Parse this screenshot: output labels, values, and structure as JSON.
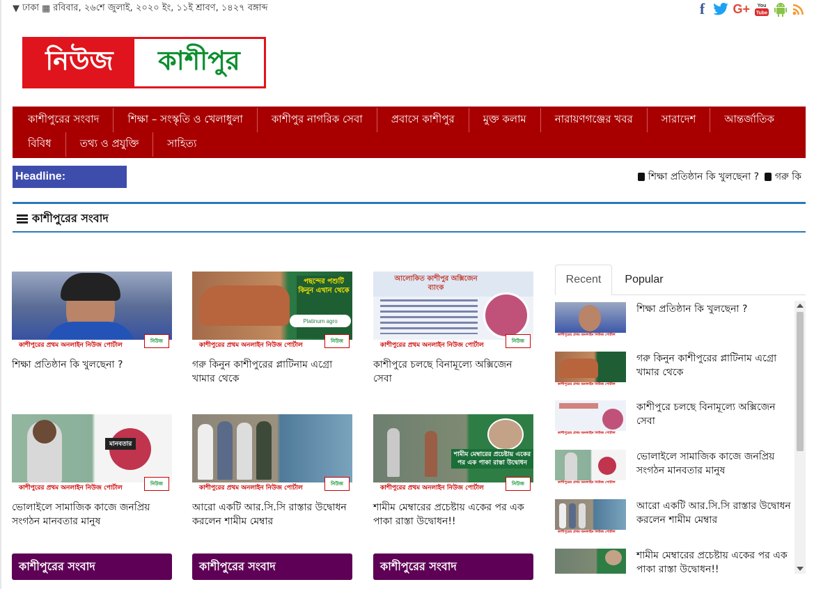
{
  "topbar": {
    "location": "ঢাকা",
    "date": "রবিবার, ২৬শে জুলাই, ২০২০ ইং, ১১ই শ্রাবণ, ১৪২৭ বঙ্গাব্দ",
    "social": [
      "f",
      "t",
      "G+",
      "You Tube",
      "android",
      "rss"
    ]
  },
  "logo": {
    "part1": "নিউজ",
    "part2": "কাশীপুর"
  },
  "nav": {
    "row1": [
      "কাশীপুরের সংবাদ",
      "শিক্ষা – সংস্কৃতি ও খেলাধুলা",
      "কাশীপুর নাগরিক সেবা",
      "প্রবাসে কাশীপুর",
      "মুক্ত কলাম",
      "নারায়ণগঞ্জের খবর",
      "সারাদেশ",
      "আন্তর্জাতিক"
    ],
    "row2": [
      "বিবিধ",
      "তথ্য ও প্রযুক্তি",
      "সাহিত্য"
    ]
  },
  "headline": {
    "label": "Headline:",
    "items": [
      "শিক্ষা প্রতিষ্ঠান কি খুলছেনা ?",
      "গরু কি"
    ]
  },
  "section": {
    "title": "কাশীপুরের সংবাদ"
  },
  "cards": [
    {
      "title": "শিক্ষা প্রতিষ্ঠান কি খুলছেনা ?",
      "band": "কাশীপুরের প্রথম অনলাইন নিউজ পোর্টাল",
      "thumb_color": "#3a62c0"
    },
    {
      "title": "গরু কিনুন কাশীপুরের প্লাটিনাম এগ্রো খামার থেকে",
      "band": "কাশীপুরের প্রথম অনলাইন নিউজ পোর্টাল",
      "overlay": "পছন্দের পশুটি কিনুন এখান থেকে",
      "thumb_color": "#8a6b3f"
    },
    {
      "title": "কাশীপুরে চলছে বিনামূল্যে অক্সিজেন সেবা",
      "band": "কাশীপুরের প্রথম অনলাইন নিউজ পোর্টাল",
      "overlay": "আলোকিত কাশীপুর অক্সিজেন ব্যাংক",
      "thumb_color": "#e9eef6"
    },
    {
      "title": "ভোলাইলে সামাজিক কাজে জনপ্রিয় সংগঠন মানবতার মানুষ",
      "band": "কাশীপুরের প্রথম অনলাইন নিউজ পোর্টাল",
      "overlay": "মানবতার",
      "thumb_color": "#8fb29a"
    },
    {
      "title": "আরো একটি আর.সি.সি রাস্তার উদ্বোধন করলেন শামীম মেম্বার",
      "band": "কাশীপুরের প্রথম অনলাইন নিউজ পোর্টাল",
      "thumb_color": "#8c8477"
    },
    {
      "title": "শামীম মেম্বারের প্রচেষ্টায় একের পর এক পাকা রাস্তা উদ্বোধন!!",
      "band": "কাশীপুরের প্রথম অনলাইন নিউজ পোর্টাল",
      "overlay": "শামীম মেম্বারের প্রচেষ্টায় একের পর এক পাকা রাস্তা উদ্বোধন",
      "thumb_color": "#6f7c6c"
    }
  ],
  "category_buttons": [
    "কাশীপুরের সংবাদ",
    "কাশীপুরের সংবাদ",
    "কাশীপুরের সংবাদ"
  ],
  "sidebar": {
    "tabs": [
      "Recent",
      "Popular"
    ],
    "items": [
      "শিক্ষা প্রতিষ্ঠান কি খুলছেনা ?",
      "গরু কিনুন কাশীপুরের প্লাটিনাম এগ্রো খামার থেকে",
      "কাশীপুরে চলছে বিনামূল্যে অক্সিজেন সেবা",
      "ভোলাইলে সামাজিক কাজে জনপ্রিয় সংগঠন মানবতার মানুষ",
      "আরো একটি আর.সি.সি রাস্তার উদ্বোধন করলেন শামীম মেম্বার",
      "শামীম মেম্বারের প্রচেষ্টায় একের পর এক পাকা রাস্তা উদ্বোধন!!"
    ]
  },
  "colors": {
    "nav": "#a80000",
    "headline": "#3e4dac",
    "category": "#5e0055",
    "section_line": "#2a78b8",
    "logo_red": "#e0141c",
    "logo_green": "#0d8f2f"
  }
}
